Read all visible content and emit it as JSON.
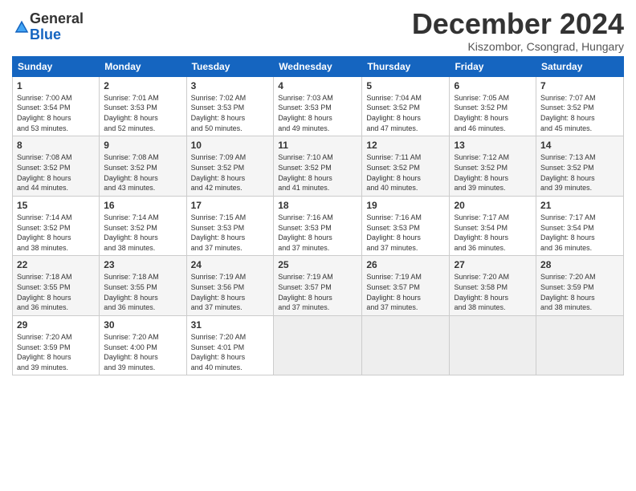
{
  "header": {
    "logo_general": "General",
    "logo_blue": "Blue",
    "title": "December 2024",
    "location": "Kiszombor, Csongrad, Hungary"
  },
  "weekdays": [
    "Sunday",
    "Monday",
    "Tuesday",
    "Wednesday",
    "Thursday",
    "Friday",
    "Saturday"
  ],
  "weeks": [
    [
      {
        "day": "1",
        "info": "Sunrise: 7:00 AM\nSunset: 3:54 PM\nDaylight: 8 hours\nand 53 minutes."
      },
      {
        "day": "2",
        "info": "Sunrise: 7:01 AM\nSunset: 3:53 PM\nDaylight: 8 hours\nand 52 minutes."
      },
      {
        "day": "3",
        "info": "Sunrise: 7:02 AM\nSunset: 3:53 PM\nDaylight: 8 hours\nand 50 minutes."
      },
      {
        "day": "4",
        "info": "Sunrise: 7:03 AM\nSunset: 3:53 PM\nDaylight: 8 hours\nand 49 minutes."
      },
      {
        "day": "5",
        "info": "Sunrise: 7:04 AM\nSunset: 3:52 PM\nDaylight: 8 hours\nand 47 minutes."
      },
      {
        "day": "6",
        "info": "Sunrise: 7:05 AM\nSunset: 3:52 PM\nDaylight: 8 hours\nand 46 minutes."
      },
      {
        "day": "7",
        "info": "Sunrise: 7:07 AM\nSunset: 3:52 PM\nDaylight: 8 hours\nand 45 minutes."
      }
    ],
    [
      {
        "day": "8",
        "info": "Sunrise: 7:08 AM\nSunset: 3:52 PM\nDaylight: 8 hours\nand 44 minutes."
      },
      {
        "day": "9",
        "info": "Sunrise: 7:08 AM\nSunset: 3:52 PM\nDaylight: 8 hours\nand 43 minutes."
      },
      {
        "day": "10",
        "info": "Sunrise: 7:09 AM\nSunset: 3:52 PM\nDaylight: 8 hours\nand 42 minutes."
      },
      {
        "day": "11",
        "info": "Sunrise: 7:10 AM\nSunset: 3:52 PM\nDaylight: 8 hours\nand 41 minutes."
      },
      {
        "day": "12",
        "info": "Sunrise: 7:11 AM\nSunset: 3:52 PM\nDaylight: 8 hours\nand 40 minutes."
      },
      {
        "day": "13",
        "info": "Sunrise: 7:12 AM\nSunset: 3:52 PM\nDaylight: 8 hours\nand 39 minutes."
      },
      {
        "day": "14",
        "info": "Sunrise: 7:13 AM\nSunset: 3:52 PM\nDaylight: 8 hours\nand 39 minutes."
      }
    ],
    [
      {
        "day": "15",
        "info": "Sunrise: 7:14 AM\nSunset: 3:52 PM\nDaylight: 8 hours\nand 38 minutes."
      },
      {
        "day": "16",
        "info": "Sunrise: 7:14 AM\nSunset: 3:52 PM\nDaylight: 8 hours\nand 38 minutes."
      },
      {
        "day": "17",
        "info": "Sunrise: 7:15 AM\nSunset: 3:53 PM\nDaylight: 8 hours\nand 37 minutes."
      },
      {
        "day": "18",
        "info": "Sunrise: 7:16 AM\nSunset: 3:53 PM\nDaylight: 8 hours\nand 37 minutes."
      },
      {
        "day": "19",
        "info": "Sunrise: 7:16 AM\nSunset: 3:53 PM\nDaylight: 8 hours\nand 37 minutes."
      },
      {
        "day": "20",
        "info": "Sunrise: 7:17 AM\nSunset: 3:54 PM\nDaylight: 8 hours\nand 36 minutes."
      },
      {
        "day": "21",
        "info": "Sunrise: 7:17 AM\nSunset: 3:54 PM\nDaylight: 8 hours\nand 36 minutes."
      }
    ],
    [
      {
        "day": "22",
        "info": "Sunrise: 7:18 AM\nSunset: 3:55 PM\nDaylight: 8 hours\nand 36 minutes."
      },
      {
        "day": "23",
        "info": "Sunrise: 7:18 AM\nSunset: 3:55 PM\nDaylight: 8 hours\nand 36 minutes."
      },
      {
        "day": "24",
        "info": "Sunrise: 7:19 AM\nSunset: 3:56 PM\nDaylight: 8 hours\nand 37 minutes."
      },
      {
        "day": "25",
        "info": "Sunrise: 7:19 AM\nSunset: 3:57 PM\nDaylight: 8 hours\nand 37 minutes."
      },
      {
        "day": "26",
        "info": "Sunrise: 7:19 AM\nSunset: 3:57 PM\nDaylight: 8 hours\nand 37 minutes."
      },
      {
        "day": "27",
        "info": "Sunrise: 7:20 AM\nSunset: 3:58 PM\nDaylight: 8 hours\nand 38 minutes."
      },
      {
        "day": "28",
        "info": "Sunrise: 7:20 AM\nSunset: 3:59 PM\nDaylight: 8 hours\nand 38 minutes."
      }
    ],
    [
      {
        "day": "29",
        "info": "Sunrise: 7:20 AM\nSunset: 3:59 PM\nDaylight: 8 hours\nand 39 minutes."
      },
      {
        "day": "30",
        "info": "Sunrise: 7:20 AM\nSunset: 4:00 PM\nDaylight: 8 hours\nand 39 minutes."
      },
      {
        "day": "31",
        "info": "Sunrise: 7:20 AM\nSunset: 4:01 PM\nDaylight: 8 hours\nand 40 minutes."
      },
      null,
      null,
      null,
      null
    ]
  ]
}
